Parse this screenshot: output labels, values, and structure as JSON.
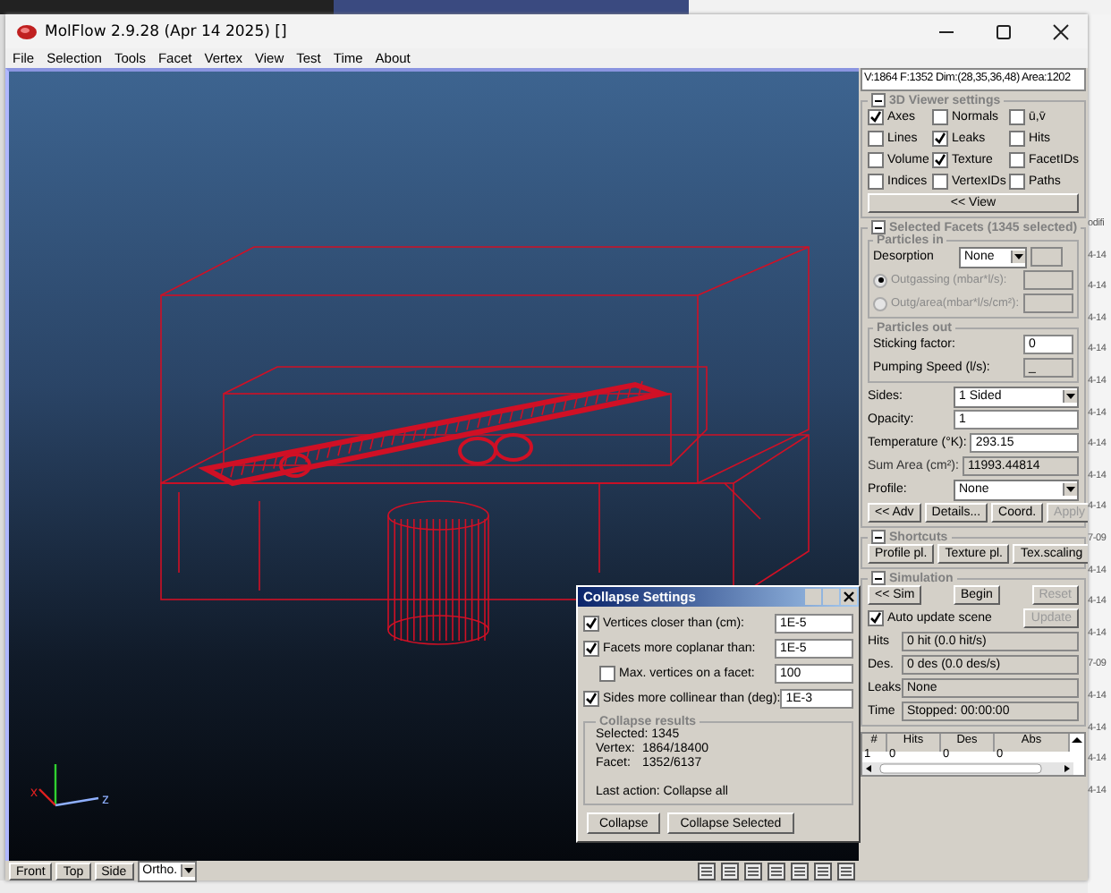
{
  "window": {
    "title": "MolFlow 2.9.28 (Apr 14 2025) []"
  },
  "menu": [
    {
      "label": "File"
    },
    {
      "label": "Selection"
    },
    {
      "label": "Tools"
    },
    {
      "label": "Facet"
    },
    {
      "label": "Vertex"
    },
    {
      "label": "View"
    },
    {
      "label": "Test"
    },
    {
      "label": "Time"
    },
    {
      "label": "About"
    }
  ],
  "viewer": {
    "axis_labels": [
      {
        "kind": "x",
        "text": "x"
      },
      {
        "kind": "z",
        "text": "z"
      }
    ],
    "view_buttons": [
      {
        "label": "Front"
      },
      {
        "label": "Top"
      },
      {
        "label": "Side"
      }
    ],
    "projection": "Ortho."
  },
  "info_bar": {
    "text": "V:1864 F:1352 Dim:(28,35,36,48) Area:1202"
  },
  "viewer_settings": {
    "title": "3D Viewer settings",
    "options": [
      {
        "label": "Axes",
        "checked": true
      },
      {
        "label": "Normals",
        "checked": false
      },
      {
        "label": "ū,v̄",
        "checked": false
      },
      {
        "label": "Lines",
        "checked": false
      },
      {
        "label": "Leaks",
        "checked": true
      },
      {
        "label": "Hits",
        "checked": false
      },
      {
        "label": "Volume",
        "checked": false
      },
      {
        "label": "Texture",
        "checked": true
      },
      {
        "label": "FacetIDs",
        "checked": false
      },
      {
        "label": "Indices",
        "checked": false
      },
      {
        "label": "VertexIDs",
        "checked": false
      },
      {
        "label": "Paths",
        "checked": false
      }
    ],
    "button": "<< View"
  },
  "selected_facets": {
    "title": "Selected Facets (1345 selected)",
    "particles_in": {
      "title": "Particles in",
      "desorption": {
        "label": "Desorption",
        "value": "None"
      },
      "modes": [
        {
          "label": "Outgassing (mbar*l/s):",
          "selected": true,
          "disabled": true
        },
        {
          "label": "Outg/area(mbar*l/s/cm²):",
          "selected": false,
          "disabled": true
        }
      ]
    },
    "particles_out": {
      "title": "Particles out",
      "fields": [
        {
          "label": "Sticking factor:",
          "value": "0",
          "disabled": false
        },
        {
          "label": "Pumping Speed (l/s):",
          "value": "_",
          "disabled": true
        }
      ]
    },
    "properties": [
      {
        "kind": "select",
        "label": "Sides:",
        "value": "1 Sided"
      },
      {
        "kind": "input",
        "label": "Opacity:",
        "value": "1"
      },
      {
        "kind": "input",
        "label": "Temperature (°K):",
        "value": "293.15"
      },
      {
        "kind": "readonly",
        "label": "Sum Area (cm²):",
        "value": "11993.44814"
      },
      {
        "kind": "select",
        "label": "Profile:",
        "value": "None"
      }
    ],
    "buttons": [
      {
        "label": "<< Adv",
        "disabled": false
      },
      {
        "label": "Details...",
        "disabled": false
      },
      {
        "label": "Coord.",
        "disabled": false
      },
      {
        "label": "Apply",
        "disabled": true
      }
    ]
  },
  "shortcuts": {
    "title": "Shortcuts",
    "buttons": [
      {
        "label": "Profile pl."
      },
      {
        "label": "Texture pl."
      },
      {
        "label": "Tex.scaling"
      }
    ]
  },
  "simulation": {
    "title": "Simulation",
    "buttons": [
      {
        "label": "<< Sim",
        "disabled": false
      },
      {
        "label": "Begin",
        "disabled": false
      },
      {
        "label": "Reset",
        "disabled": true
      }
    ],
    "auto_update": {
      "label": "Auto update scene",
      "checked": true
    },
    "update_button": {
      "label": "Update",
      "disabled": true
    },
    "stats": [
      {
        "label": "Hits",
        "value": "0 hit (0.0 hit/s)"
      },
      {
        "label": "Des.",
        "value": "0 des (0.0 des/s)"
      },
      {
        "label": "Leaks",
        "value": "None"
      },
      {
        "label": "Time",
        "value": "Stopped: 00:00:00"
      }
    ]
  },
  "hits_table": {
    "columns": [
      "#",
      "Hits",
      "Des",
      "Abs"
    ],
    "rows": [
      [
        "1",
        "0",
        "0",
        "0"
      ]
    ]
  },
  "collapse_dialog": {
    "title": "Collapse Settings",
    "options": [
      {
        "kind": "main",
        "label": "Vertices closer than (cm):",
        "checked": true,
        "value": "1E-5"
      },
      {
        "kind": "main",
        "label": "Facets more coplanar than:",
        "checked": true,
        "value": "1E-5"
      },
      {
        "kind": "sub",
        "label": "Max. vertices on a facet:",
        "checked": false,
        "value": "100"
      },
      {
        "kind": "main",
        "label": "Sides more collinear than (deg):",
        "checked": true,
        "value": "1E-3"
      }
    ],
    "results": {
      "title": "Collapse results",
      "selected": "Selected: 1345",
      "lines": [
        {
          "label": "Vertex:",
          "value": "1864/18400"
        },
        {
          "label": "Facet:",
          "value": "1352/6137"
        }
      ],
      "last_action": "Last action: Collapse all"
    },
    "buttons": [
      {
        "label": "Collapse"
      },
      {
        "label": "Collapse Selected"
      }
    ]
  },
  "background_list": {
    "header": "odifi",
    "items": [
      "4-14",
      "4-14",
      "4-14",
      "4-14",
      "4-14",
      "4-14",
      "4-14",
      "4-14",
      "4-14",
      "7-09",
      "4-14",
      "4-14",
      "4-14",
      "7-09",
      "4-14",
      "4-14",
      "4-14",
      "4-14"
    ]
  }
}
